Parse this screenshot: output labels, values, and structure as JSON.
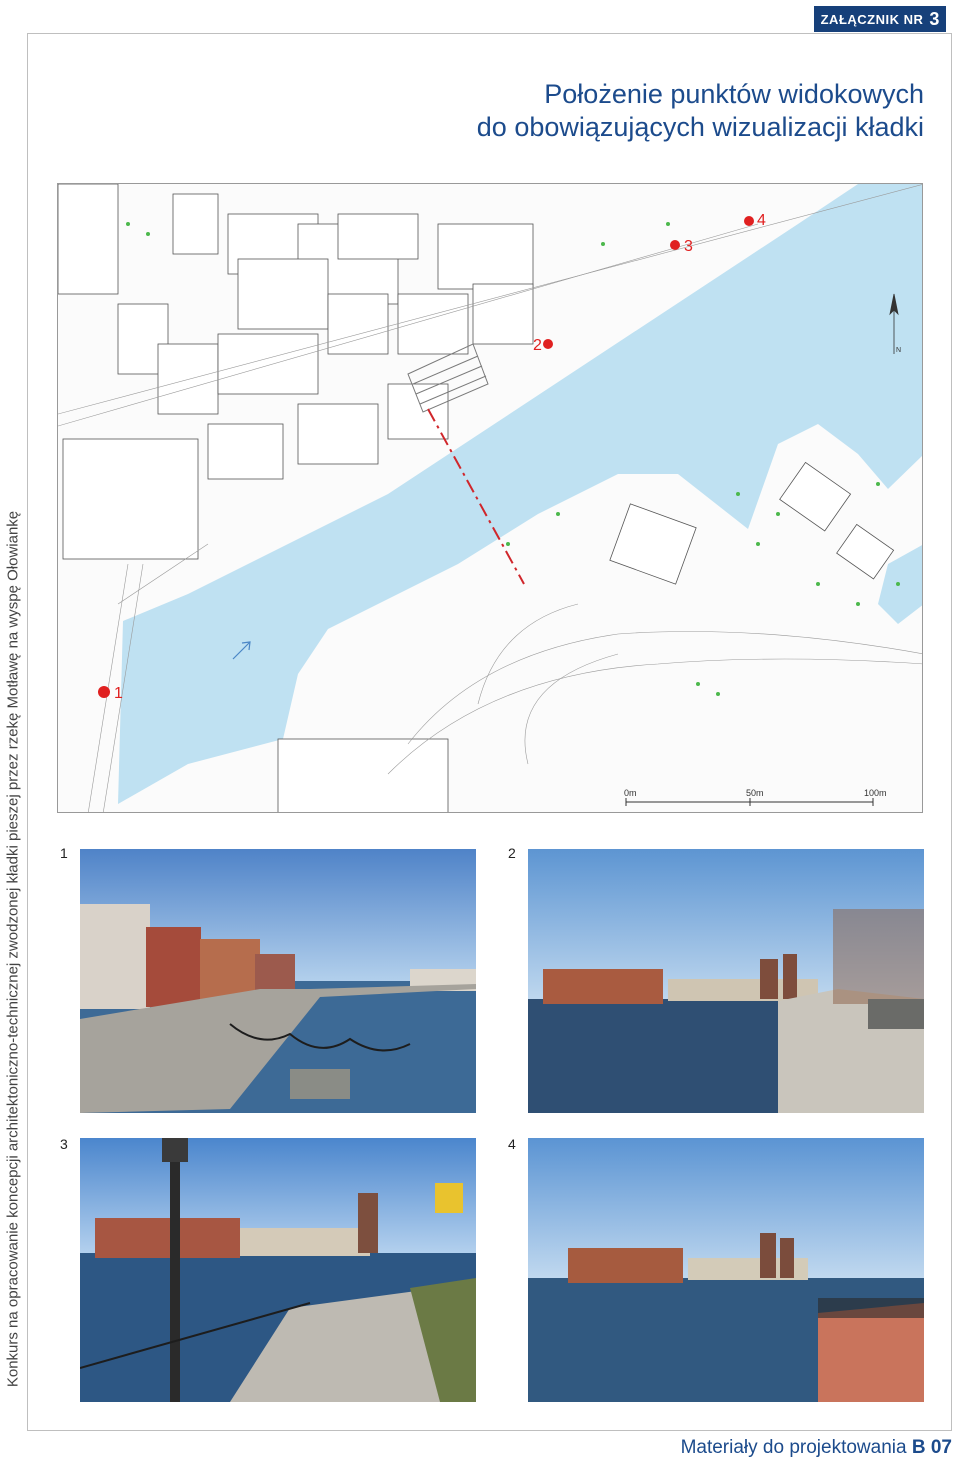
{
  "annex": {
    "label": "ZAŁĄCZNIK NR",
    "number": "3"
  },
  "title": {
    "line1": "Położenie punktów widokowych",
    "line2": "do obowiązujących wizualizacji kładki"
  },
  "sidebar_text": "Konkurs na opracowanie koncepcji architektoniczno-technicznej zwodzonej kładki pieszej przez rzekę Motławę na wyspę Ołowiankę",
  "map": {
    "viewpoints": [
      "1",
      "2",
      "3",
      "4"
    ],
    "scale": {
      "start": "0m",
      "mid": "50m",
      "end": "100m"
    },
    "north": "N"
  },
  "photos": [
    {
      "number": "1"
    },
    {
      "number": "2"
    },
    {
      "number": "3"
    },
    {
      "number": "4"
    }
  ],
  "footer": {
    "text": "Materiały do projektowania",
    "code": "B 07"
  },
  "colors": {
    "accent": "#1c4b8c",
    "badge": "#16407a",
    "water": "#bfe1f2",
    "marker": "#e02020"
  }
}
